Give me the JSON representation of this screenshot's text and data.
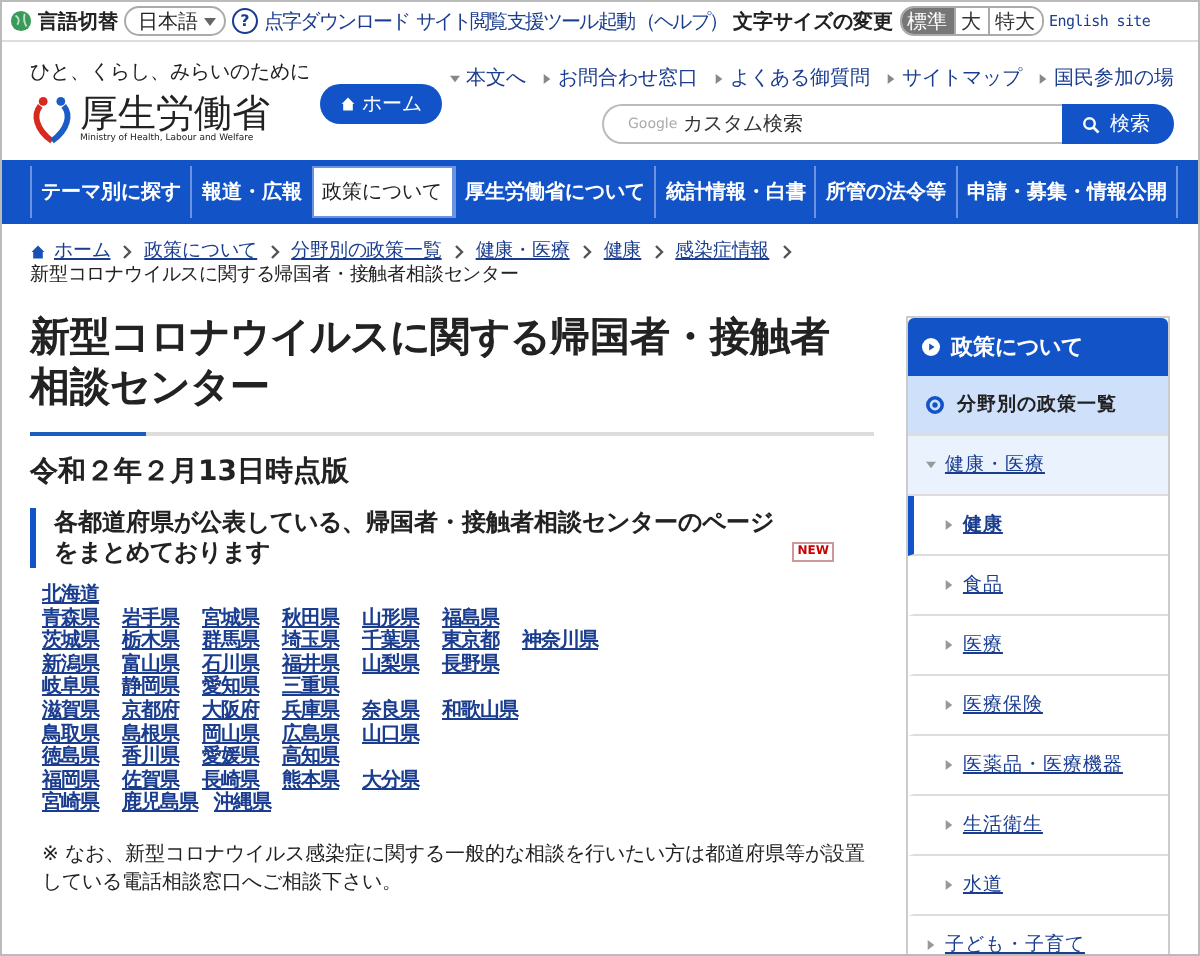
{
  "top_bar": {
    "language_label": "言語切替",
    "language": "日本語",
    "help": "?",
    "links": [
      "点字ダウンロード",
      "サイト閲覧支援ツール起動"
    ],
    "help_link": "（ヘルプ）",
    "font_size_label": "文字サイズの変更",
    "font_sizes": [
      {
        "label": "標準",
        "selected": true
      },
      {
        "label": "大",
        "selected": false
      },
      {
        "label": "特大",
        "selected": false
      }
    ],
    "english": "English site"
  },
  "header": {
    "tagline": "ひと、くらし、みらいのために",
    "logo_name": "厚生労働省",
    "logo_sub": "Ministry of Health, Labour and Welfare",
    "home_button": "ホーム",
    "links": [
      {
        "label": "本文へ",
        "kind": "down"
      },
      {
        "label": "お問合わせ窓口",
        "kind": "right"
      },
      {
        "label": "よくある御質問",
        "kind": "right"
      },
      {
        "label": "サイトマップ",
        "kind": "right"
      },
      {
        "label": "国民参加の場",
        "kind": "right"
      }
    ],
    "search": {
      "brand": "Google",
      "placeholder": "カスタム検索",
      "button": "検索"
    }
  },
  "nav": [
    {
      "label": "テーマ別に探す",
      "selected": false
    },
    {
      "label": "報道・広報",
      "selected": false
    },
    {
      "label": "政策について",
      "selected": true
    },
    {
      "label": "厚生労働省について",
      "selected": false
    },
    {
      "label": "統計情報・白書",
      "selected": false
    },
    {
      "label": "所管の法令等",
      "selected": false
    },
    {
      "label": "申請・募集・情報公開",
      "selected": false
    }
  ],
  "breadcrumb": [
    "ホーム",
    "政策について",
    "分野別の政策一覧",
    "健康・医療",
    "健康",
    "感染症情報",
    "新型コロナウイルスに関する帰国者・接触者相談センター"
  ],
  "main": {
    "title": "新型コロナウイルスに関する帰国者・接触者相談センター",
    "date": "令和２年２月13日時点版",
    "lead": "各都道府県が公表している、帰国者・接触者相談センターのページをまとめております",
    "badge": "NEW",
    "prefecture_rows": [
      [
        "北海道"
      ],
      [
        "青森県",
        "岩手県",
        "宮城県",
        "秋田県",
        "山形県",
        "福島県"
      ],
      [
        "茨城県",
        "栃木県",
        "群馬県",
        "埼玉県",
        "千葉県",
        "東京都",
        "神奈川県"
      ],
      [
        "新潟県",
        "富山県",
        "石川県",
        "福井県",
        "山梨県",
        "長野県"
      ],
      [
        "岐阜県",
        "静岡県",
        "愛知県",
        "三重県"
      ],
      [
        "滋賀県",
        "京都府",
        "大阪府",
        "兵庫県",
        "奈良県",
        "和歌山県"
      ],
      [
        "鳥取県",
        "島根県",
        "岡山県",
        "広島県",
        "山口県"
      ],
      [
        "徳島県",
        "香川県",
        "愛媛県",
        "高知県"
      ],
      [
        "福岡県",
        "佐賀県",
        "長崎県",
        "熊本県",
        "大分県"
      ],
      [
        "宮崎県",
        "鹿児島県",
        "沖縄県"
      ]
    ],
    "note": "※ なお、新型コロナウイルス感染症に関する一般的な相談を行いたい方は都道府県等が設置している電話相談窓口へご相談下さい。"
  },
  "sidebar": {
    "title": "政策について",
    "section": "分野別の政策一覧",
    "categories": [
      {
        "label": "健康・医療",
        "expanded": true,
        "children": [
          {
            "label": "健康",
            "selected": true
          },
          {
            "label": "食品",
            "selected": false
          },
          {
            "label": "医療",
            "selected": false
          },
          {
            "label": "医療保険",
            "selected": false
          },
          {
            "label": "医薬品・医療機器",
            "selected": false
          },
          {
            "label": "生活衛生",
            "selected": false
          },
          {
            "label": "水道",
            "selected": false
          }
        ]
      },
      {
        "label": "子ども・子育て",
        "expanded": false
      }
    ]
  }
}
